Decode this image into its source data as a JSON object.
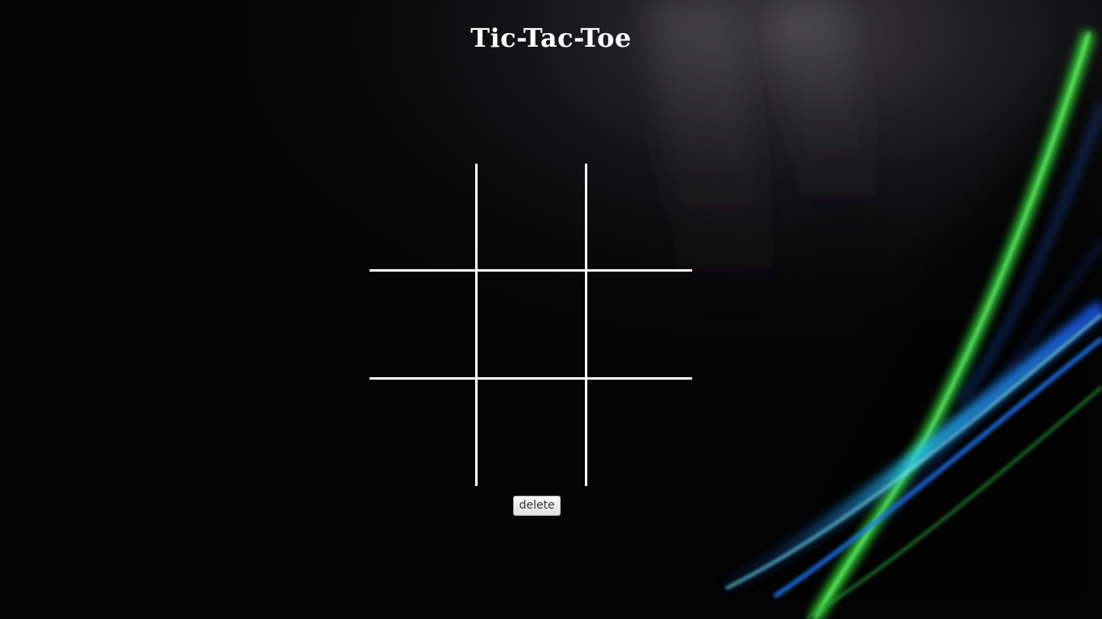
{
  "page": {
    "title": "Tic-Tac-Toe"
  },
  "board": {
    "cells": [
      "",
      "",
      "",
      "",
      "",
      "",
      "",
      "",
      ""
    ]
  },
  "controls": {
    "delete_label": "delete"
  },
  "colors": {
    "background": "#050505",
    "grid_line": "#ffffff",
    "title": "#ffffff",
    "accent_blue": "#1e7bff",
    "accent_green": "#3dff3d"
  }
}
